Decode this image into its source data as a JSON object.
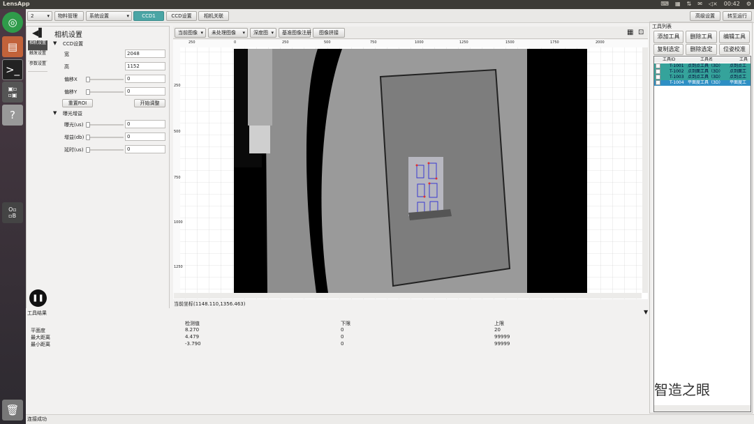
{
  "window": {
    "title": "LensApp",
    "clock": "00:42"
  },
  "toolbar": {
    "combo_value": "2",
    "material_mgmt": "物料管理",
    "system_settings": "系统设置",
    "tab_ccd1": "CCD1",
    "tab_ccd_settings": "CCD设置",
    "tab_camera_link": "相机关联",
    "advanced_settings": "高级设置",
    "switch_run": "转至运行"
  },
  "left": {
    "title": "相机设置",
    "vtabs": [
      "相机设置",
      "触发设置",
      "参数设置"
    ],
    "ccd_section": "CCD设置",
    "width_label": "宽",
    "width_value": "2048",
    "height_label": "高",
    "height_value": "1152",
    "offset_x_label": "偏移X",
    "offset_x_value": "0",
    "offset_y_label": "偏移Y",
    "offset_y_value": "0",
    "reset_roi": "重置ROI",
    "start_adjust": "开始调整",
    "exposure_section": "曝光增益",
    "exposure_label": "曝光(us)",
    "exposure_value": "0",
    "gain_label": "增益(db)",
    "gain_value": "0",
    "delay_label": "延时(us)",
    "delay_value": "0"
  },
  "viewer": {
    "current_image": "当前图像",
    "unprocessed": "未处理图像",
    "depth_map": "深度图",
    "ref_register": "基准图像注册",
    "stitch": "图像拼接",
    "coords": "当前坐标(1148.110,1356.463)",
    "ruler_top": [
      "250",
      "0",
      "250",
      "500",
      "750",
      "1000",
      "1250",
      "1500",
      "1750",
      "2000"
    ],
    "ruler_left": [
      "250",
      "500",
      "750",
      "1000",
      "1250"
    ]
  },
  "right": {
    "title": "工具列表",
    "add": "添加工具",
    "delete": "删除工具",
    "edit": "编辑工具",
    "copy_sel": "复制选定",
    "delete_sel": "删除选定",
    "pose_calib": "位姿校准",
    "headers": [
      "工具ID",
      "工具名",
      "工具"
    ],
    "rows": [
      {
        "id": "T-1001",
        "name": "点到点工具（3D）",
        "type": "点到点工"
      },
      {
        "id": "T-1002",
        "name": "点到面工具（3D）",
        "type": "点到面工"
      },
      {
        "id": "T-1003",
        "name": "点到点工具（3D）",
        "type": "点到点工"
      },
      {
        "id": "T-1004",
        "name": "平面度工具（3D）",
        "type": "平面度工"
      }
    ]
  },
  "results": {
    "title": "工具结果",
    "headers": [
      "检测值",
      "下限",
      "上限"
    ],
    "rows": [
      {
        "name": "平面度",
        "value": "8.270",
        "low": "0",
        "high": "20"
      },
      {
        "name": "最大距离",
        "value": "4.479",
        "low": "0",
        "high": "99999"
      },
      {
        "name": "最小距离",
        "value": "-3.790",
        "low": "0",
        "high": "99999"
      }
    ]
  },
  "status": {
    "text": "连接成功"
  },
  "watermark": {
    "text": "智造之眼"
  },
  "colors": {
    "accent": "#4aa5a5",
    "list_highlight": "#2e8fc4",
    "rect_blue": "#3a3ad0",
    "rect_red": "#e03030"
  }
}
